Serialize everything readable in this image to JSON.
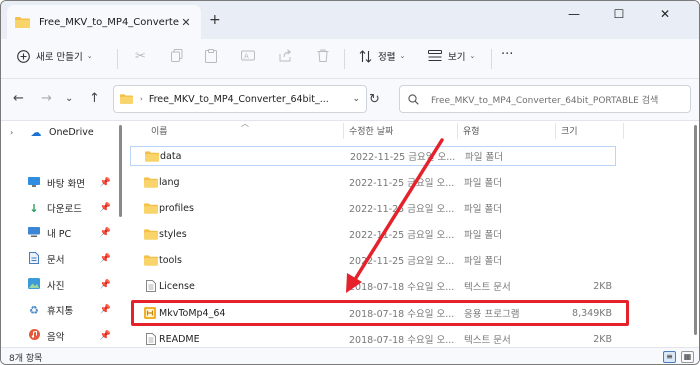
{
  "window": {
    "tab_title": "Free_MKV_to_MP4_Converter_",
    "tab_close_glyph": "✕",
    "new_tab_glyph": "+",
    "minimize_glyph": "—",
    "maximize_glyph": "☐",
    "close_glyph": "✕"
  },
  "toolbar": {
    "new_label": "새로 만들기",
    "sort_label": "정렬",
    "view_label": "보기",
    "more_glyph": "···"
  },
  "address": {
    "path": "Free_MKV_to_MP4_Converter_64bit_...",
    "search_placeholder": "Free_MKV_to_MP4_Converter_64bit_PORTABLE 검색"
  },
  "sidebar": {
    "items": [
      {
        "label": "OneDrive",
        "icon": "cloud-icon",
        "pinned": false
      },
      {
        "label": "바탕 화면",
        "icon": "desktop-icon",
        "pinned": true
      },
      {
        "label": "다운로드",
        "icon": "download-icon",
        "pinned": true
      },
      {
        "label": "내 PC",
        "icon": "pc-icon",
        "pinned": true
      },
      {
        "label": "문서",
        "icon": "document-icon",
        "pinned": true
      },
      {
        "label": "사진",
        "icon": "pictures-icon",
        "pinned": true
      },
      {
        "label": "휴지통",
        "icon": "recycle-bin-icon",
        "pinned": true
      },
      {
        "label": "음악",
        "icon": "music-icon",
        "pinned": true
      }
    ]
  },
  "list": {
    "headers": {
      "name": "이름",
      "date": "수정한 날짜",
      "type": "유형",
      "size": "크기"
    },
    "rows": [
      {
        "name": "data",
        "date": "2022-11-25 금요일 오...",
        "type": "파일 폴더",
        "size": "",
        "icon": "folder-icon"
      },
      {
        "name": "lang",
        "date": "2022-11-25 금요일 오...",
        "type": "파일 폴더",
        "size": "",
        "icon": "folder-icon"
      },
      {
        "name": "profiles",
        "date": "2022-11-25 금요일 오...",
        "type": "파일 폴더",
        "size": "",
        "icon": "folder-icon"
      },
      {
        "name": "styles",
        "date": "2022-11-25 금요일 오...",
        "type": "파일 폴더",
        "size": "",
        "icon": "folder-icon"
      },
      {
        "name": "tools",
        "date": "2022-11-25 금요일 오...",
        "type": "파일 폴더",
        "size": "",
        "icon": "folder-icon"
      },
      {
        "name": "License",
        "date": "2018-07-18 수요일 오...",
        "type": "텍스트 문서",
        "size": "2KB",
        "icon": "text-file-icon"
      },
      {
        "name": "MkvToMp4_64",
        "date": "2018-07-18 수요일 오...",
        "type": "응용 프로그램",
        "size": "8,349KB",
        "icon": "application-icon"
      },
      {
        "name": "README",
        "date": "2018-07-18 수요일 오...",
        "type": "텍스트 문서",
        "size": "2KB",
        "icon": "text-file-icon"
      }
    ]
  },
  "status": {
    "item_count": "8개 항목"
  },
  "colors": {
    "highlight": "#e5222c",
    "folder": "#f4c04a",
    "accent": "#0067c0"
  }
}
